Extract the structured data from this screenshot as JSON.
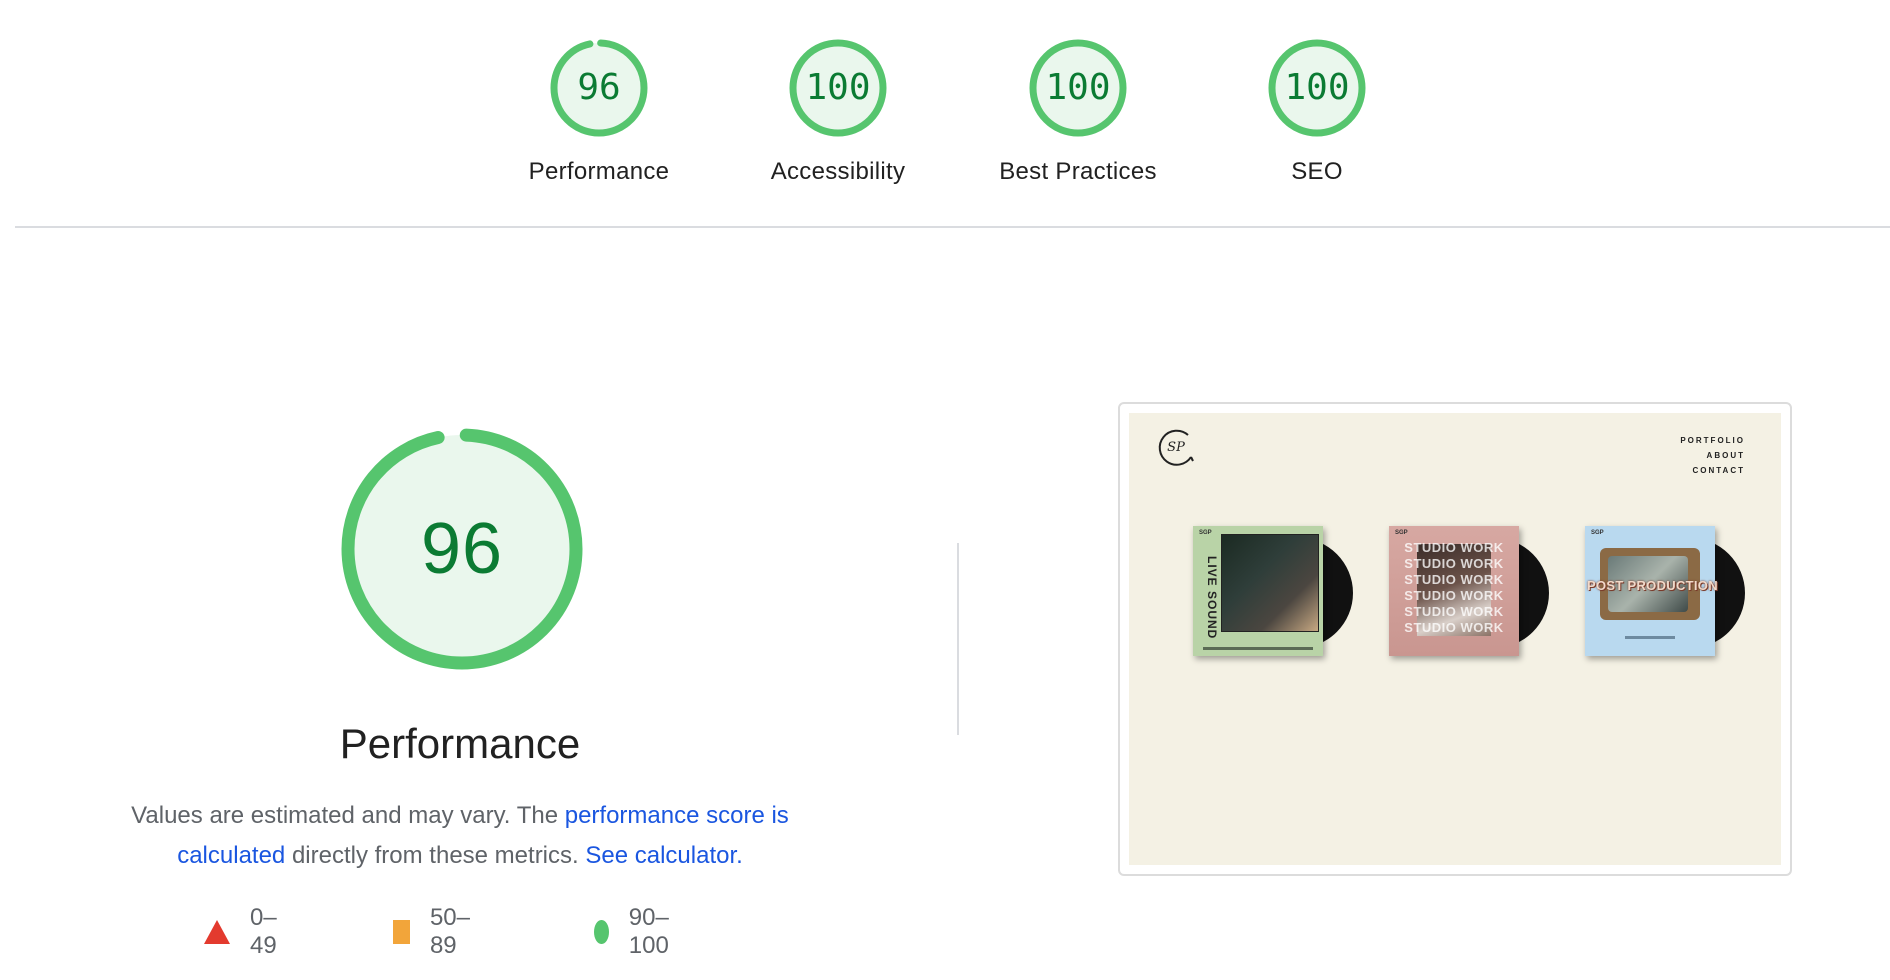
{
  "summary": {
    "categories": [
      {
        "label": "Performance",
        "score": "96",
        "value": 96
      },
      {
        "label": "Accessibility",
        "score": "100",
        "value": 100
      },
      {
        "label": "Best Practices",
        "score": "100",
        "value": 100
      },
      {
        "label": "SEO",
        "score": "100",
        "value": 100
      }
    ]
  },
  "performance": {
    "title": "Performance",
    "score": "96",
    "value": 96,
    "description": {
      "part1": "Values are estimated and may vary. The ",
      "link1": "performance score is calculated",
      "part2": " directly from these metrics. ",
      "link2": "See calculator."
    },
    "legend": [
      {
        "range": "0–49",
        "icon": "red-triangle-icon"
      },
      {
        "range": "50–89",
        "icon": "orange-square-icon"
      },
      {
        "range": "90–100",
        "icon": "green-circle-icon"
      }
    ]
  },
  "screenshot": {
    "logo_text": "SP",
    "nav": [
      "PORTFOLIO",
      "ABOUT",
      "CONTACT"
    ],
    "albums": [
      {
        "title": "LIVE SOUND",
        "tag": "SGP"
      },
      {
        "title": "STUDIO WORK",
        "tag": "SGP"
      },
      {
        "title": "POST PRODUCTION",
        "tag": "SGP"
      }
    ]
  },
  "colors": {
    "pass_green": "#0b7b33",
    "ring_green": "#56c56e",
    "ring_bg": "#eaf7ed",
    "link_blue": "#1a56e0",
    "fail_red": "#e33a2e",
    "average_orange": "#f2a53a"
  }
}
